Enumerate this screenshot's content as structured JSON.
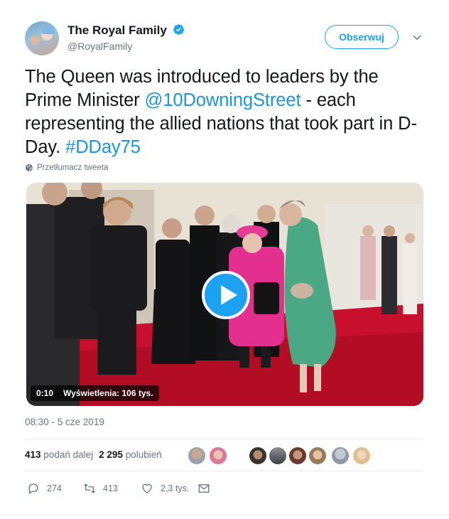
{
  "account": {
    "name": "The Royal Family",
    "handle": "@RoyalFamily",
    "follow_label": "Obserwuj"
  },
  "tweet": {
    "text_before": "The Queen was introduced to leaders by the Prime Minister ",
    "mention": "@10DowningStreet",
    "text_middle": " - each representing the allied nations that took part in D-Day. ",
    "hashtag": "#DDay75",
    "translate_label": "Przetłumacz tweeta"
  },
  "video": {
    "duration": "0:10",
    "views": "Wyświetlenia: 106 tys."
  },
  "timestamp": "08:30 - 5 cze 2019",
  "stats": {
    "retweets_count": "413",
    "retweets_label": "podań dalej",
    "likes_count": "2 295",
    "likes_label": "polubień"
  },
  "actions": {
    "replies": "274",
    "retweets": "413",
    "likes": "2,3 tys."
  },
  "colors": {
    "accent": "#1da1f2",
    "verified": "#1da1f2",
    "secondary_text": "#657786"
  }
}
